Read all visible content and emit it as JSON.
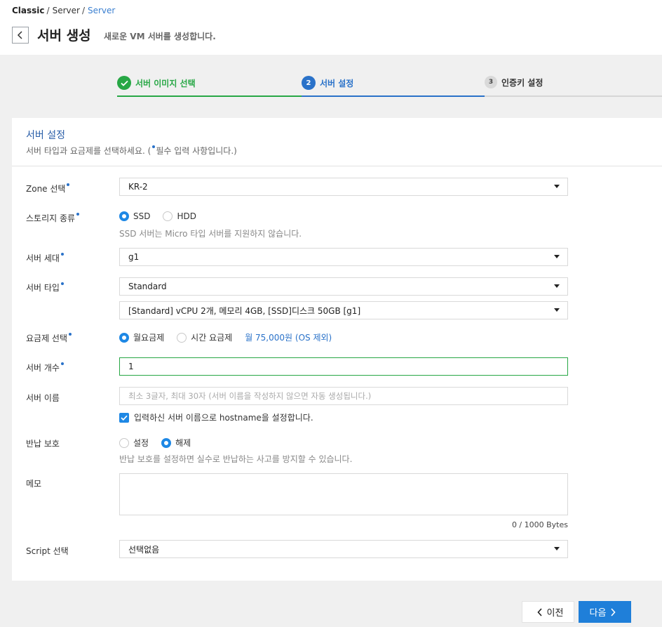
{
  "breadcrumb": {
    "items": [
      "Classic",
      "Server",
      "Server"
    ]
  },
  "header": {
    "title": "서버 생성",
    "subtitle": "새로운 VM 서버를 생성합니다."
  },
  "steps": [
    {
      "num": "",
      "label": "서버 이미지 선택",
      "state": "done"
    },
    {
      "num": "2",
      "label": "서버 설정",
      "state": "active"
    },
    {
      "num": "3",
      "label": "인증키 설정",
      "state": "pending"
    }
  ],
  "section": {
    "title": "서버 설정",
    "desc_prefix": "서버 타입과 요금제를 선택하세요. (",
    "desc_suffix": "필수 입력 사항입니다.)"
  },
  "fields": {
    "zone": {
      "label": "Zone 선택",
      "value": "KR-2"
    },
    "storage": {
      "label": "스토리지 종류",
      "options": [
        "SSD",
        "HDD"
      ],
      "selected": "SSD",
      "hint": "SSD 서버는 Micro 타입 서버를 지원하지 않습니다."
    },
    "generation": {
      "label": "서버 세대",
      "value": "g1"
    },
    "server_type": {
      "label": "서버 타입",
      "value": "Standard",
      "spec_value": "[Standard] vCPU 2개, 메모리 4GB, [SSD]디스크 50GB [g1]"
    },
    "billing": {
      "label": "요금제 선택",
      "options": [
        "월요금제",
        "시간 요금제"
      ],
      "selected": "월요금제",
      "price": "월 75,000원 (OS 제외)"
    },
    "count": {
      "label": "서버 개수",
      "value": "1"
    },
    "name": {
      "label": "서버 이름",
      "placeholder": "최소 3글자, 최대 30자 (서버 이름을 작성하지 않으면 자동 생성됩니다.)",
      "hostname_check": "입력하신 서버 이름으로 hostname을 설정합니다."
    },
    "return_protect": {
      "label": "반납 보호",
      "options": [
        "설정",
        "해제"
      ],
      "selected": "해제",
      "hint": "반납 보호를 설정하면 실수로 반납하는 사고를 방지할 수 있습니다."
    },
    "memo": {
      "label": "메모",
      "counter": "0 / 1000 Bytes"
    },
    "script": {
      "label": "Script 선택",
      "value": "선택없음"
    }
  },
  "buttons": {
    "prev": "이전",
    "next": "다음"
  },
  "colors": {
    "accent": "#1f7fd9",
    "success": "#27a745",
    "link": "#3a7fd0"
  }
}
